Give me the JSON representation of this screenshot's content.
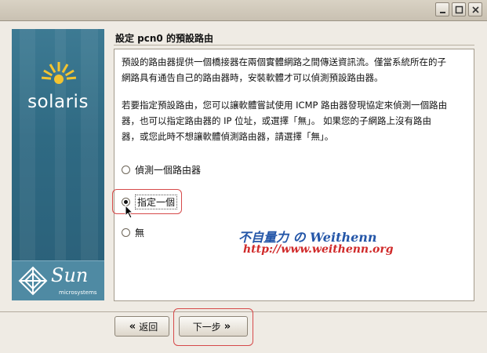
{
  "window": {
    "buttons": [
      "minimize-icon",
      "maximize-icon",
      "close-icon"
    ]
  },
  "sidebar": {
    "brand": "solaris",
    "sun_logo": "Sun",
    "sun_sub": "microsystems"
  },
  "header": {
    "title": "設定 pcn0 的預設路由"
  },
  "content": {
    "para1_line1": "預設的路由器提供一個橋接器在兩個實體網路之間傳送資訊流。僅當系統所在的子",
    "para1_line2": "網路具有通告自己的路由器時，安裝軟體才可以偵測預設路由器。",
    "para2_line1": "若要指定預設路由，您可以讓軟體嘗試使用 ICMP 路由器發現協定來偵測一個路由",
    "para2_line2": "器，也可以指定路由器的 IP 位址，或選擇「無」。 如果您的子網路上沒有路由",
    "para2_line3": "器，或您此時不想讓軟體偵測路由器，請選擇「無」。",
    "options": [
      {
        "label": "偵測一個路由器",
        "selected": false
      },
      {
        "label": "指定一個",
        "selected": true
      },
      {
        "label": "無",
        "selected": false
      }
    ]
  },
  "watermark": {
    "line1": "不自量力 の Weithenn",
    "line2": "http://www.weithenn.org"
  },
  "footer": {
    "back_label": "返回",
    "next_label": "下一步"
  },
  "colors": {
    "sidebar": "#2f6a83",
    "highlight": "#d64a4a",
    "watermark_blue": "#2456a8",
    "watermark_red": "#d02a2a"
  }
}
